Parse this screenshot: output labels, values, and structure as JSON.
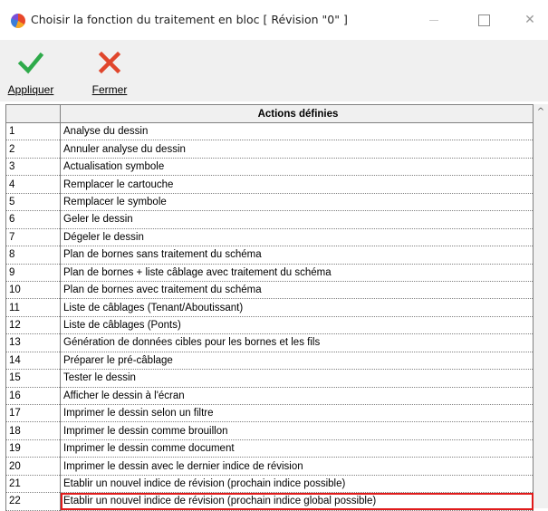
{
  "window": {
    "title": "Choisir la fonction du traitement en bloc [ Révision \"0\" ]",
    "minimize_glyph": "—",
    "close_glyph": "✕"
  },
  "toolbar": {
    "apply_label": "Appliquer",
    "apply_icon": "checkmark-icon",
    "apply_color": "#2eaa4a",
    "close_label": "Fermer",
    "close_icon": "cross-icon",
    "close_color": "#e0462c"
  },
  "table": {
    "header_num": "",
    "header_action": "Actions définies",
    "highlight_color": "#e01b1b",
    "highlighted_row": 22,
    "rows": [
      {
        "num": "1",
        "action": "Analyse du dessin"
      },
      {
        "num": "2",
        "action": "Annuler analyse du dessin"
      },
      {
        "num": "3",
        "action": "Actualisation symbole"
      },
      {
        "num": "4",
        "action": "Remplacer le cartouche"
      },
      {
        "num": "5",
        "action": "Remplacer le symbole"
      },
      {
        "num": "6",
        "action": "Geler le dessin"
      },
      {
        "num": "7",
        "action": "Dégeler le dessin"
      },
      {
        "num": "8",
        "action": "Plan de bornes sans traitement du schéma"
      },
      {
        "num": "9",
        "action": "Plan de bornes + liste câblage avec traitement du schéma"
      },
      {
        "num": "10",
        "action": "Plan de bornes avec traitement du schéma"
      },
      {
        "num": "11",
        "action": "Liste de câblages (Tenant/Aboutissant)"
      },
      {
        "num": "12",
        "action": "Liste de câblages (Ponts)"
      },
      {
        "num": "13",
        "action": "Génération de données cibles pour les bornes et les fils"
      },
      {
        "num": "14",
        "action": "Préparer le pré-câblage"
      },
      {
        "num": "15",
        "action": "Tester le dessin"
      },
      {
        "num": "16",
        "action": "Afficher le dessin à l'écran"
      },
      {
        "num": "17",
        "action": "Imprimer le dessin selon un filtre"
      },
      {
        "num": "18",
        "action": "Imprimer le dessin comme brouillon"
      },
      {
        "num": "19",
        "action": "Imprimer le dessin comme document"
      },
      {
        "num": "20",
        "action": "Imprimer le dessin avec le dernier indice de révision"
      },
      {
        "num": "21",
        "action": "Etablir un nouvel indice de révision (prochain indice possible)"
      },
      {
        "num": "22",
        "action": "Etablir un nouvel indice de révision (prochain indice global possible)"
      }
    ]
  },
  "scrollbar": {
    "up_glyph": "^"
  }
}
